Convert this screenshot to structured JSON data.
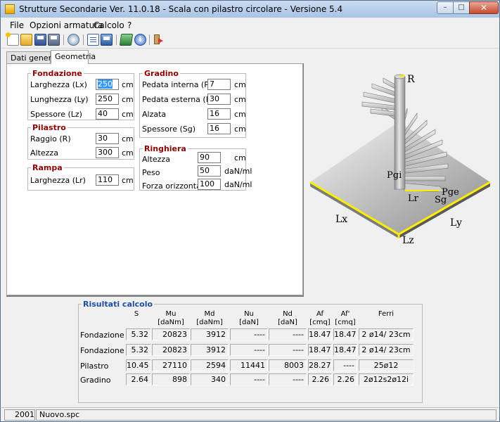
{
  "window": {
    "title": "Strutture Secondarie Ver. 11.0.18 - Scala con pilastro circolare - Versione 5.4",
    "min_glyph": "–",
    "max_glyph": "□",
    "close_glyph": "✕"
  },
  "menu": [
    "File",
    "Opzioni armatura",
    "Calcolo",
    "?"
  ],
  "toolbar": {
    "icons": [
      "new-icon",
      "open-icon",
      "save-icon",
      "save-as-icon",
      "settings-icon",
      "report-icon",
      "print-preview-icon",
      "book-icon",
      "info-icon",
      "exit-icon"
    ]
  },
  "tabs": [
    "Dati generali",
    "Geometria"
  ],
  "geometria": {
    "fondazione": {
      "title": "Fondazione",
      "rows": [
        {
          "label": "Larghezza (Lx)",
          "value": "250",
          "unit": "cm"
        },
        {
          "label": "Lunghezza (Ly)",
          "value": "250",
          "unit": "cm"
        },
        {
          "label": "Spessore (Lz)",
          "value": "40",
          "unit": "cm"
        }
      ]
    },
    "pilastro": {
      "title": "Pilastro",
      "rows": [
        {
          "label": "Raggio (R)",
          "value": "30",
          "unit": "cm"
        },
        {
          "label": "Altezza",
          "value": "300",
          "unit": "cm"
        }
      ]
    },
    "rampa": {
      "title": "Rampa",
      "rows": [
        {
          "label": "Larghezza (Lr)",
          "value": "110",
          "unit": "cm"
        }
      ]
    },
    "gradino": {
      "title": "Gradino",
      "rows": [
        {
          "label": "Pedata interna (Pgi)",
          "value": "7",
          "unit": "cm"
        },
        {
          "label": "Pedata esterna (Pge)",
          "value": "30",
          "unit": "cm"
        },
        {
          "label": "Alzata",
          "value": "16",
          "unit": "cm"
        },
        {
          "label": "Spessore (Sg)",
          "value": "16",
          "unit": "cm"
        }
      ]
    },
    "ringhiera": {
      "title": "Ringhiera",
      "rows": [
        {
          "label": "Altezza",
          "value": "90",
          "unit": "cm"
        },
        {
          "label": "Peso",
          "value": "50",
          "unit": "daN/ml"
        },
        {
          "label": "Forza orizzontale",
          "value": "100",
          "unit": "daN/ml"
        }
      ]
    }
  },
  "drawing_labels": {
    "R": "R",
    "Pgi": "Pgi",
    "Pge": "Pge",
    "Lr": "Lr",
    "Sg": "Sg",
    "Lx": "Lx",
    "Ly": "Ly",
    "Lz": "Lz"
  },
  "results": {
    "title": "Risultati calcolo",
    "headers": [
      {
        "top": "S",
        "bottom": ""
      },
      {
        "top": "Mu",
        "bottom": "[daNm]"
      },
      {
        "top": "Md",
        "bottom": "[daNm]"
      },
      {
        "top": "Nu",
        "bottom": "[daN]"
      },
      {
        "top": "Nd",
        "bottom": "[daN]"
      },
      {
        "top": "Af",
        "bottom": "[cmq]"
      },
      {
        "top": "Af'",
        "bottom": "[cmq]"
      },
      {
        "top": "Ferri",
        "bottom": ""
      }
    ],
    "rows": [
      {
        "label": "Fondazione X",
        "cells": [
          "5.32",
          "20823",
          "3912",
          "----",
          "----",
          "18.47",
          "18.47",
          "2 ø14/ 23cm"
        ]
      },
      {
        "label": "Fondazione Y",
        "cells": [
          "5.32",
          "20823",
          "3912",
          "----",
          "----",
          "18.47",
          "18.47",
          "2 ø14/ 23cm"
        ]
      },
      {
        "label": "Pilastro",
        "cells": [
          "10.45",
          "27110",
          "2594",
          "11441",
          "8003",
          "28.27",
          "----",
          "25ø12"
        ]
      },
      {
        "label": "Gradino",
        "cells": [
          "2.64",
          "898",
          "340",
          "----",
          "----",
          "2.26",
          "2.26",
          "2ø12s2ø12i"
        ]
      }
    ]
  },
  "status": {
    "year": "2001",
    "file": "Nuovo.spc"
  }
}
